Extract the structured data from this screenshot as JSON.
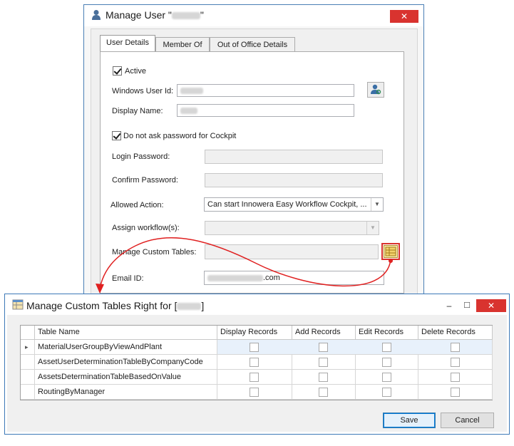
{
  "user_dialog": {
    "title": "Manage User \"",
    "title_end": "\"",
    "tabs": [
      "User Details",
      "Member Of",
      "Out of Office Details"
    ],
    "active_label": "Active",
    "windows_user_id_label": "Windows User Id:",
    "display_name_label": "Display Name:",
    "no_password_label": "Do not ask password for Cockpit",
    "login_password_label": "Login Password:",
    "confirm_password_label": "Confirm Password:",
    "allowed_action_label": "Allowed Action:",
    "allowed_action_value": "Can start Innowera Easy Workflow Cockpit, ...",
    "assign_workflow_label": "Assign workflow(s):",
    "manage_custom_tables_label": "Manage Custom Tables:",
    "email_label": "Email ID:",
    "email_suffix": ".com",
    "close_glyph": "✕"
  },
  "tables_dialog": {
    "title": "Manage Custom Tables Right for [",
    "title_end": "]",
    "minimize_glyph": "–",
    "maximize_glyph": "□",
    "close_glyph": "✕",
    "columns": [
      "Table Name",
      "Display Records",
      "Add Records",
      "Edit Records",
      "Delete Records"
    ],
    "rows": [
      {
        "name": "MaterialUserGroupByViewAndPlant"
      },
      {
        "name": "AssetUserDeterminationTableByCompanyCode"
      },
      {
        "name": "AssetsDeterminationTableBasedOnValue"
      },
      {
        "name": "RoutingByManager"
      }
    ],
    "row_indicator": "▸",
    "save_label": "Save",
    "cancel_label": "Cancel"
  },
  "colors": {
    "accent": "#d9332f",
    "window_border": "#4a7fb5",
    "selected_row": "#e8f1fb",
    "arrow": "#e02020"
  }
}
